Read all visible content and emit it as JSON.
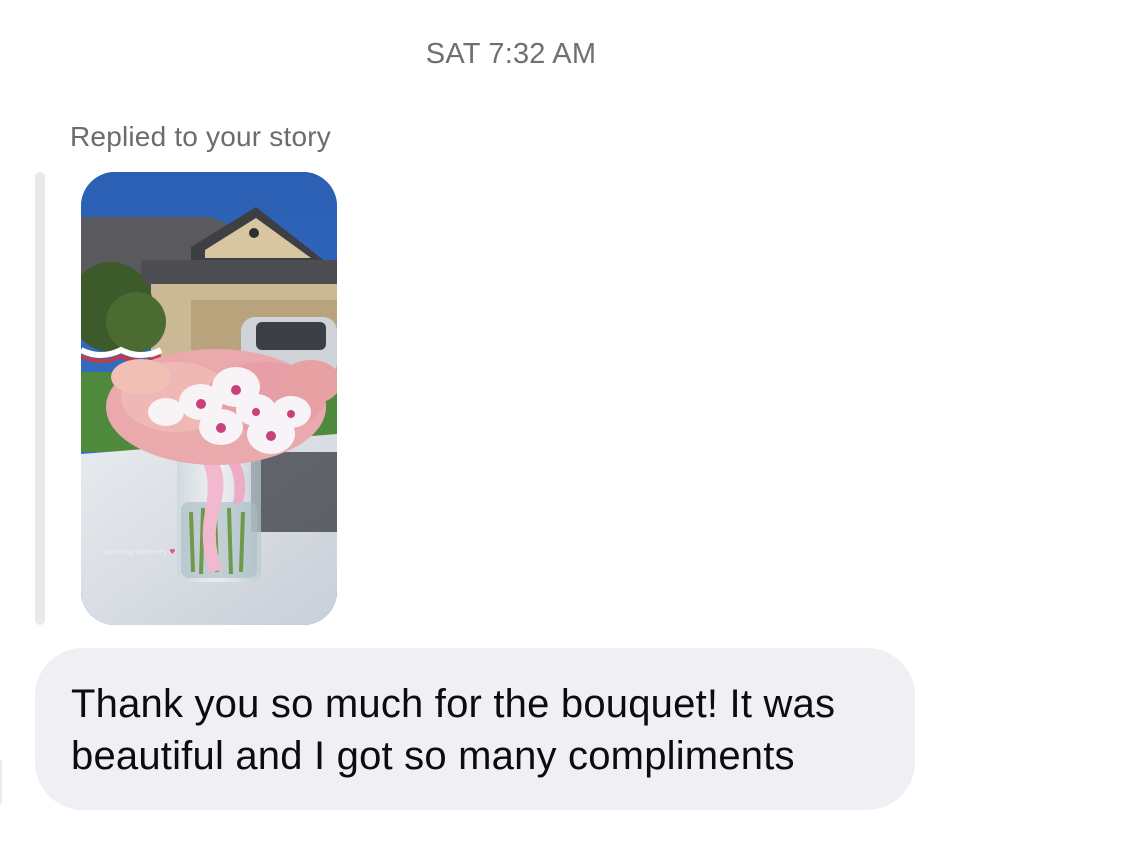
{
  "conversation": {
    "timestamp": "SAT 7:32 AM",
    "reply_context": {
      "label": "Replied to your story",
      "story_thumbnail": {
        "description_icon": "story-image",
        "overlay_text": "morning delivery",
        "overlay_emoji": "♥"
      }
    },
    "message": {
      "text": "Thank you so much for the bouquet! It was beautiful and I got so many compliments"
    }
  },
  "colors": {
    "background": "#ffffff",
    "bubble": "#efeff4",
    "reply_bar": "#e9e9ec",
    "secondary_text": "#6f6f74",
    "primary_text": "#0c0c0d"
  }
}
